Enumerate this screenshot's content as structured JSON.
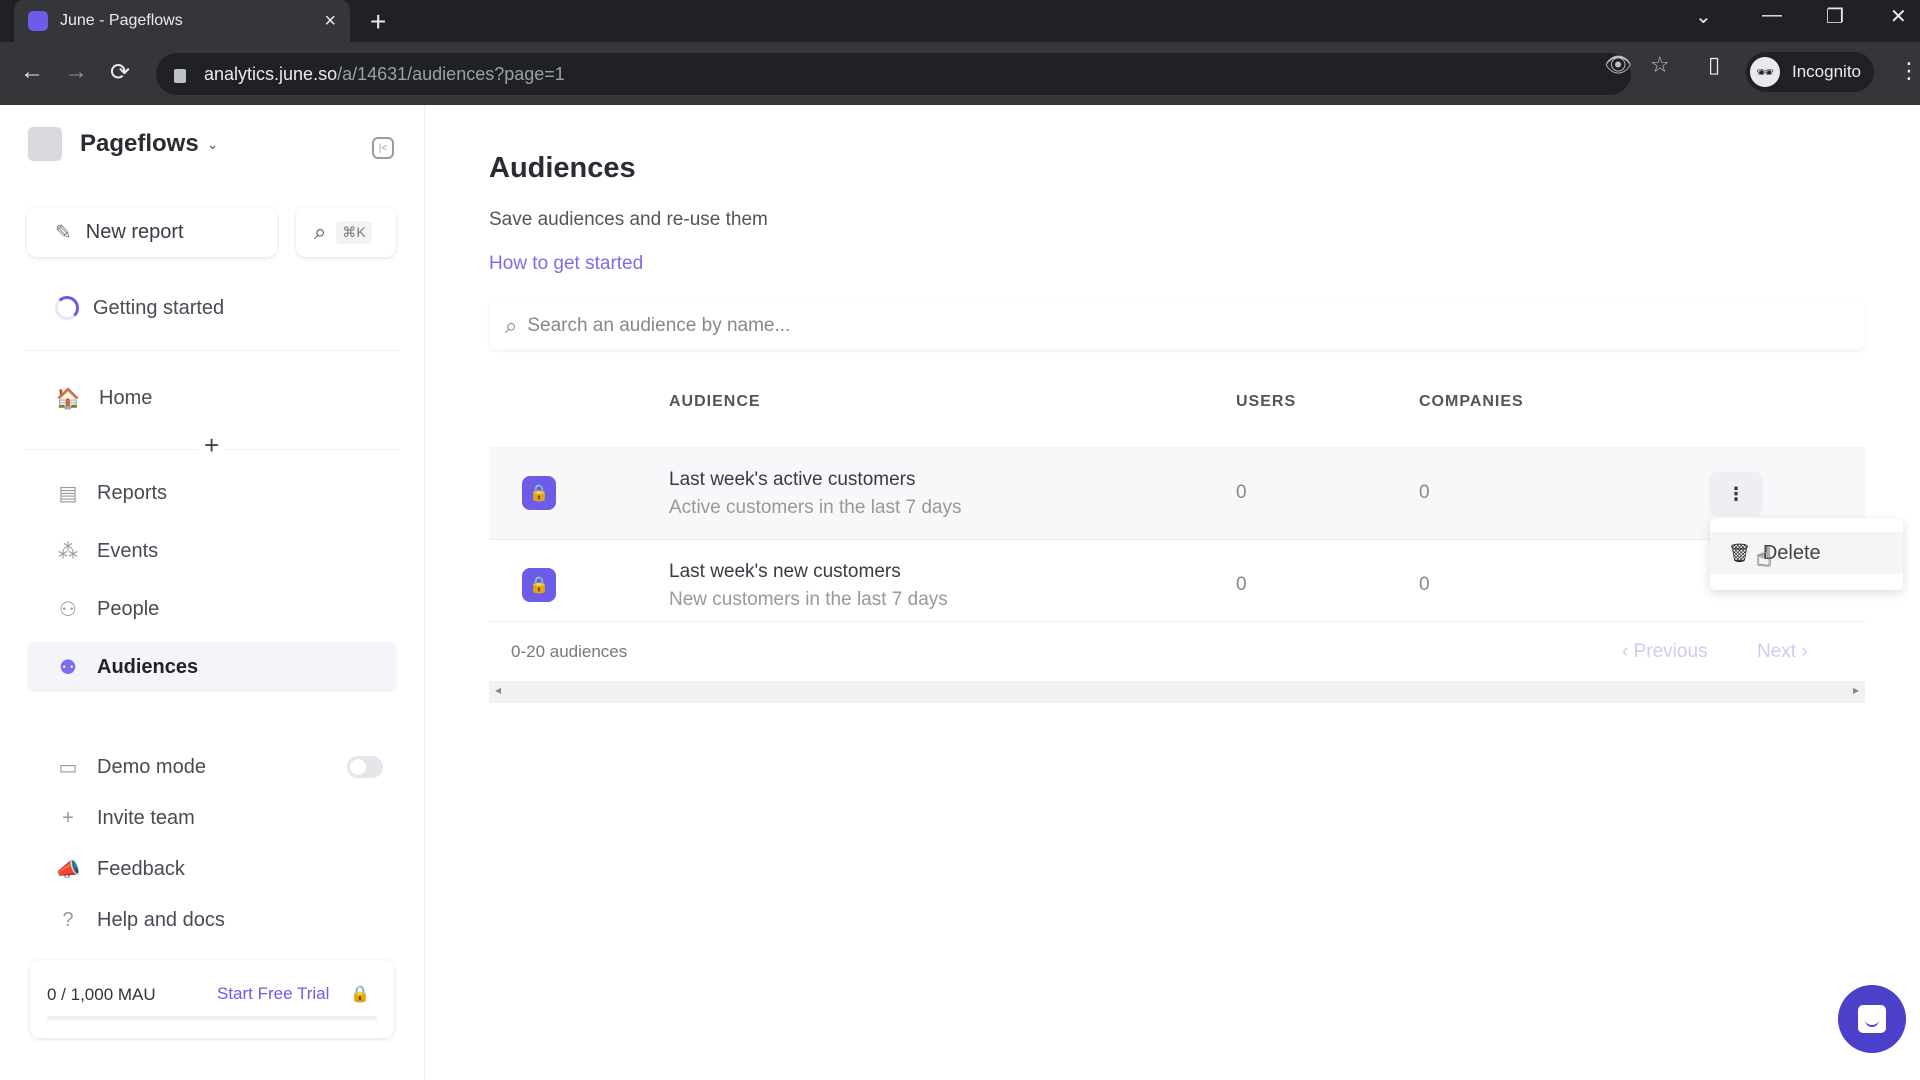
{
  "browser": {
    "tab_title": "June - Pageflows",
    "tab_close": "×",
    "new_tab": "+",
    "url_host": "analytics.june.so",
    "url_path": "/a/14631/audiences?page=1",
    "profile_label": "Incognito",
    "icons": {
      "back": "←",
      "forward": "→",
      "reload": "⟳",
      "tab_list": "⌄",
      "minimize": "—",
      "restore": "❐",
      "close": "✕",
      "eye_off": "👁",
      "star": "☆",
      "side_panel": "▯",
      "menu": "⋮",
      "incognito": "🕶"
    }
  },
  "sidebar": {
    "workspace_name": "Pageflows",
    "workspace_chevron": "⌄",
    "collapse_icon": "|<",
    "new_report_label": "New report",
    "new_report_icon": "✎",
    "search_icon": "⌕",
    "search_shortcut": "⌘K",
    "getting_started": "Getting started",
    "home": {
      "label": "Home",
      "icon": "🏠"
    },
    "add_icon": "+",
    "items": [
      {
        "label": "Reports",
        "icon": "▤"
      },
      {
        "label": "Events",
        "icon": "⁂"
      },
      {
        "label": "People",
        "icon": "⚇"
      },
      {
        "label": "Audiences",
        "icon": "⚉",
        "active": true
      }
    ],
    "demo_mode": {
      "label": "Demo mode",
      "icon": "▭",
      "enabled": false
    },
    "invite_team": {
      "label": "Invite team",
      "icon": "+"
    },
    "feedback": {
      "label": "Feedback",
      "icon": "📣"
    },
    "help": {
      "label": "Help and docs",
      "icon": "?"
    },
    "mau": {
      "count": "0 / 1,000 MAU",
      "progress": 0,
      "trial_label": "Start Free Trial",
      "lock_icon": "🔒"
    }
  },
  "main": {
    "title": "Audiences",
    "subtitle": "Save audiences and re-use them",
    "help_link": "How to get started",
    "search_placeholder": "Search an audience by name...",
    "search_icon": "⌕",
    "columns": {
      "audience": "AUDIENCE",
      "users": "USERS",
      "companies": "COMPANIES"
    },
    "rows": [
      {
        "name": "Last week's active customers",
        "description": "Active customers in the last 7 days",
        "users": "0",
        "companies": "0",
        "lock_icon": "🔒",
        "more_icon": "⋮"
      },
      {
        "name": "Last week's new customers",
        "description": "New customers in the last 7 days",
        "users": "0",
        "companies": "0",
        "lock_icon": "🔒"
      }
    ],
    "context_menu": {
      "delete_label": "Delete",
      "delete_icon": "🗑"
    },
    "footer_count": "0-20 audiences",
    "previous_label": "‹ Previous",
    "next_label": "Next ›",
    "scroll_left": "◂",
    "scroll_right": "▸"
  },
  "colors": {
    "accent": "#6c5ce7",
    "chat": "#4c3fc9"
  }
}
